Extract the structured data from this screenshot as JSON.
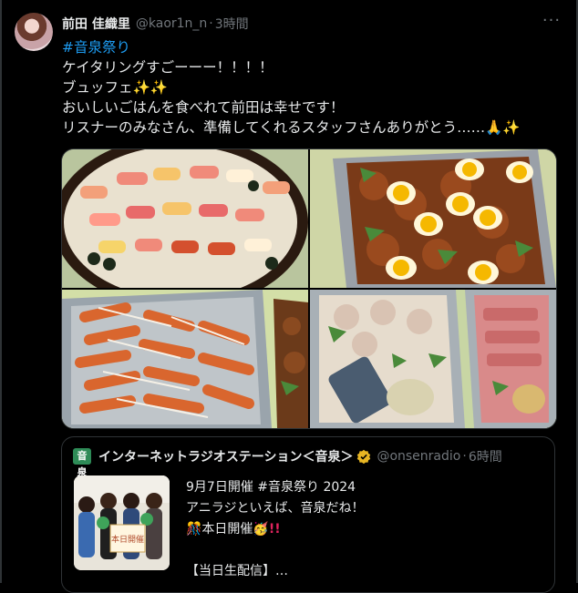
{
  "post": {
    "author_name": "前田 佳織里",
    "author_handle": "@kaor1n_n",
    "time_ago": "3時間",
    "hashtag": "#音泉祭り",
    "lines": [
      "ケイタリングすごーーー！！！！",
      "ブュッフェ✨✨",
      "おいしいごはんを食べれて前田は幸せです！",
      "リスナーのみなさん、準備してくれるスタッフさんありがとう……🙏✨"
    ]
  },
  "icons": {
    "more": "more-dots-icon",
    "verified": "verified-badge-icon",
    "avatar": "avatar-image"
  },
  "quote": {
    "logo_text": "音泉",
    "name": "インターネットラジオステーション＜音泉＞",
    "handle": "@onsenradio",
    "time_ago": "6時間",
    "lines": [
      "9月7日開催 #音泉祭り 2024",
      "アニラジといえば、音泉だね！",
      "🎊本日開催🥳",
      "!!",
      "",
      "【当日生配信】…"
    ],
    "thumb_sign": "本日開催"
  },
  "colors": {
    "background": "#000000",
    "text": "#e7e9ea",
    "muted": "#71767b",
    "link": "#1d9bf0",
    "verified": "#e8b623",
    "alert": "#e0245e"
  }
}
